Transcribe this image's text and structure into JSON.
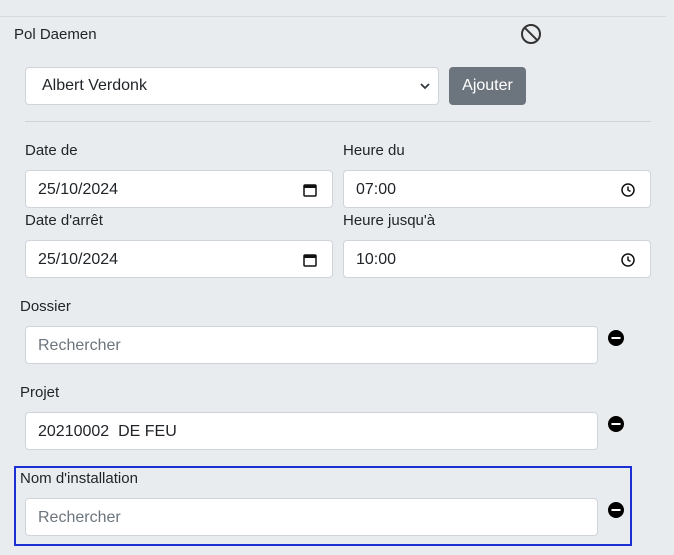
{
  "person": {
    "name": "Pol Daemen",
    "ban_icon": "ban-icon"
  },
  "assign": {
    "selected": "Albert Verdonk",
    "add_label": "Ajouter"
  },
  "schedule": {
    "date_from_label": "Date de",
    "date_from_value": "25/10/2024",
    "time_from_label": "Heure du",
    "time_from_value": "07:00",
    "date_to_label": "Date d'arrêt",
    "date_to_value": "25/10/2024",
    "time_to_label": "Heure jusqu'à",
    "time_to_value": "10:00"
  },
  "dossier": {
    "label": "Dossier",
    "placeholder": "Rechercher"
  },
  "projet": {
    "label": "Projet",
    "value": "20210002  DE FEU"
  },
  "installation": {
    "label": "Nom d'installation",
    "placeholder": "Rechercher"
  },
  "colors": {
    "background": "#e9ecef",
    "button": "#6c757d",
    "highlight": "#1c2fd6"
  }
}
